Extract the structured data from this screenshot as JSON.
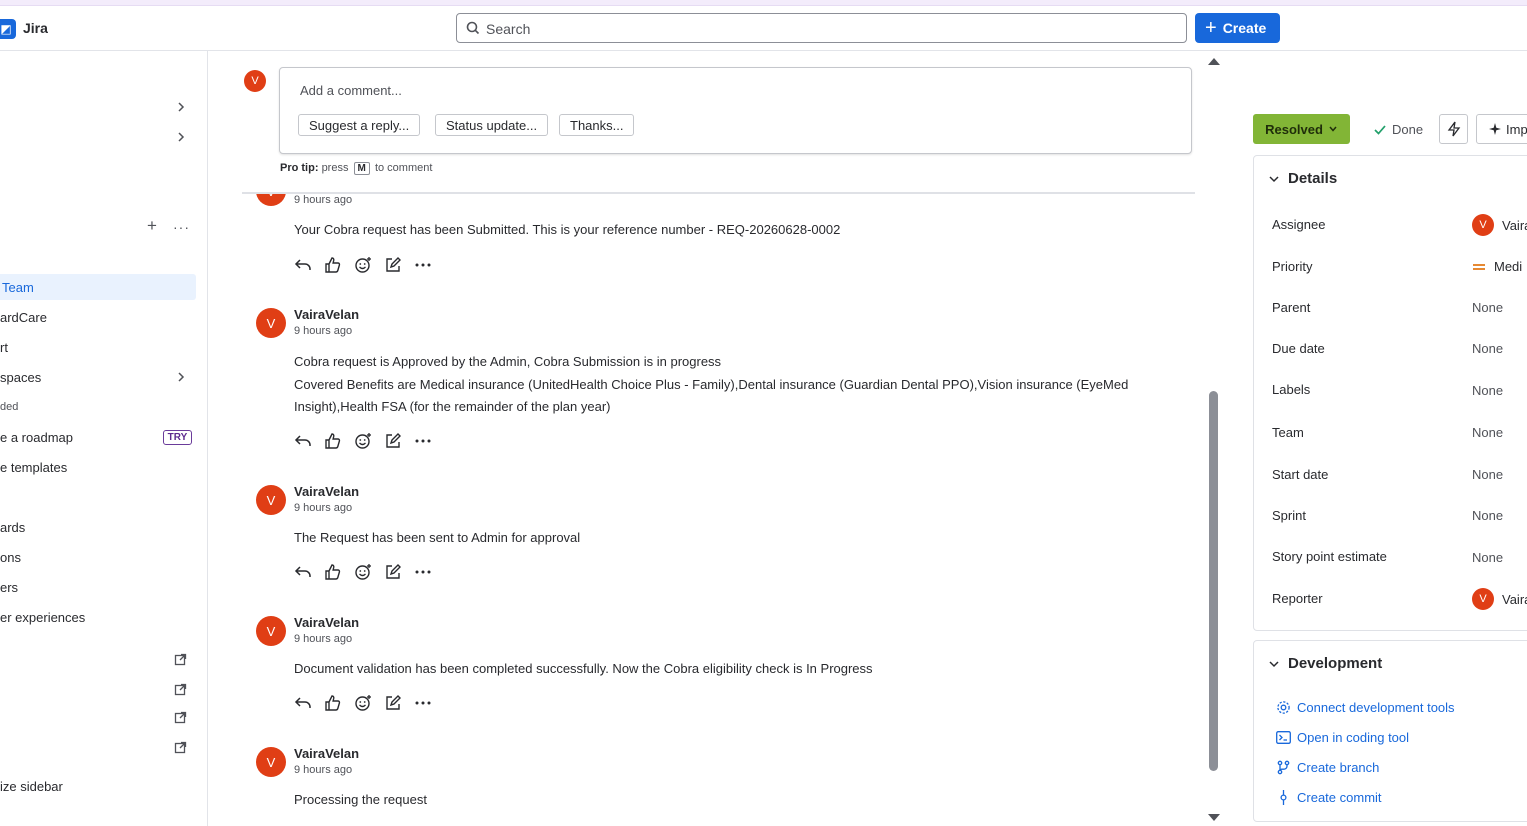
{
  "app": {
    "name": "Jira",
    "logo_icon": "jira-logo-icon"
  },
  "search": {
    "placeholder": "Search"
  },
  "create": {
    "label": "Create"
  },
  "sidebar": {
    "rows": [
      {
        "label": "Team",
        "active": true
      },
      {
        "label": "ardCare"
      },
      {
        "label": "rt"
      },
      {
        "label": "spaces"
      },
      {
        "label": "ded"
      },
      {
        "label": "e a roadmap",
        "badge": "TRY"
      },
      {
        "label": "e templates"
      },
      {
        "label": "ards"
      },
      {
        "label": "ons"
      },
      {
        "label": "ers"
      },
      {
        "label": "er experiences"
      },
      {
        "label": "ize sidebar"
      }
    ]
  },
  "comment": {
    "avatar": "V",
    "placeholder": "Add a comment...",
    "suggestions": [
      "Suggest a reply...",
      "Status update...",
      "Thanks..."
    ],
    "protip_bold": "Pro tip:",
    "protip_pre": "press",
    "protip_key": "M",
    "protip_post": "to comment"
  },
  "activity": [
    {
      "author": "",
      "avatar": "V",
      "time": "9 hours ago",
      "lines": [
        "Your Cobra request has been Submitted. This is your reference number - REQ-20260628-0002"
      ]
    },
    {
      "author": "VairaVelan",
      "avatar": "V",
      "time": "9 hours ago",
      "lines": [
        "Cobra request is Approved by the Admin, Cobra Submission is in progress",
        "Covered Benefits are Medical insurance (UnitedHealth Choice Plus - Family),Dental insurance (Guardian Dental PPO),Vision insurance (EyeMed Insight),Health FSA (for the remainder of the plan year)"
      ]
    },
    {
      "author": "VairaVelan",
      "avatar": "V",
      "time": "9 hours ago",
      "lines": [
        "The Request has been sent to Admin for approval"
      ]
    },
    {
      "author": "VairaVelan",
      "avatar": "V",
      "time": "9 hours ago",
      "lines": [
        "Document validation has been completed successfully. Now the Cobra eligibility check is In Progress"
      ]
    },
    {
      "author": "VairaVelan",
      "avatar": "V",
      "time": "9 hours ago",
      "lines": [
        "Processing the request"
      ]
    }
  ],
  "issue": {
    "status": "Resolved",
    "resolution": "Done",
    "improve_label": "Imp",
    "status_color": "#82b536"
  },
  "details": {
    "title": "Details",
    "fields": [
      {
        "label": "Assignee",
        "value": "Vaira",
        "avatar": "V"
      },
      {
        "label": "Priority",
        "value": "Medi",
        "icon": "priority-medium-icon"
      },
      {
        "label": "Parent",
        "value": "None"
      },
      {
        "label": "Due date",
        "value": "None"
      },
      {
        "label": "Labels",
        "value": "None"
      },
      {
        "label": "Team",
        "value": "None"
      },
      {
        "label": "Start date",
        "value": "None"
      },
      {
        "label": "Sprint",
        "value": "None"
      },
      {
        "label": "Story point estimate",
        "value": "None"
      },
      {
        "label": "Reporter",
        "value": "Vaira",
        "avatar": "V"
      }
    ]
  },
  "development": {
    "title": "Development",
    "links": [
      {
        "label": "Connect development tools",
        "icon": "gear-icon"
      },
      {
        "label": "Open in coding tool",
        "icon": "terminal-icon"
      },
      {
        "label": "Create branch",
        "icon": "branch-icon"
      },
      {
        "label": "Create commit",
        "icon": "commit-icon"
      }
    ]
  }
}
